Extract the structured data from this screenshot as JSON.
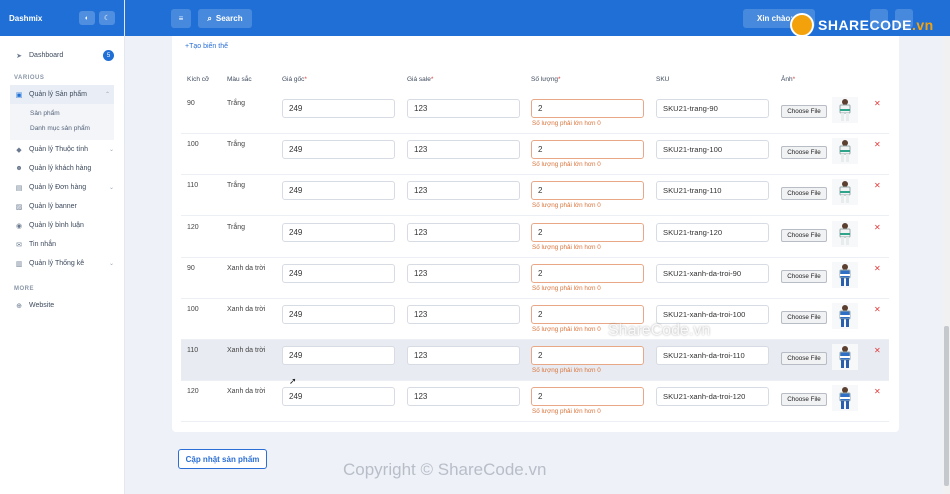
{
  "brand": {
    "name": "Dashmix",
    "theme_icon": "toggle-icon",
    "moon_icon": "moon-icon"
  },
  "topbar": {
    "search_label": "Search",
    "user_label": "Xin chào: H",
    "logo_text": "SHARECODE",
    "logo_tld": ".vn"
  },
  "sidebar": {
    "dashboard": {
      "label": "Dashboard",
      "badge": "5"
    },
    "section_various": "VARIOUS",
    "products": {
      "label": "Quản lý Sản phẩm",
      "sub": [
        "Sản phẩm",
        "Danh mục sản phẩm"
      ]
    },
    "items": [
      {
        "label": "Quản lý Thuộc tính",
        "icon": "tag-icon",
        "chev": true
      },
      {
        "label": "Quản lý khách hàng",
        "icon": "users-icon",
        "chev": false
      },
      {
        "label": "Quản lý Đơn hàng",
        "icon": "cart-icon",
        "chev": true
      },
      {
        "label": "Quản lý banner",
        "icon": "image-icon",
        "chev": false
      },
      {
        "label": "Quản lý bình luận",
        "icon": "comment-icon",
        "chev": false
      },
      {
        "label": "Tin nhắn",
        "icon": "mail-icon",
        "chev": false
      },
      {
        "label": "Quản lý Thống kê",
        "icon": "chart-icon",
        "chev": true
      }
    ],
    "section_more": "MORE",
    "website": "Website"
  },
  "form": {
    "add_variant": "+Tạo biến thể",
    "headers": {
      "size": "Kích cỡ",
      "color": "Màu sắc",
      "price": "Giá gốc",
      "sale": "Giá sale",
      "qty": "Số lượng",
      "sku": "SKU",
      "image": "Ảnh"
    },
    "required_mark": "*",
    "file_button": "Choose File",
    "error_msg": "Số lượng phải lớn hơn 0",
    "rows": [
      {
        "size": "90",
        "color": "Trắng",
        "price": "249",
        "sale": "123",
        "qty": "2",
        "sku": "SKU21-trang-90"
      },
      {
        "size": "100",
        "color": "Trắng",
        "price": "249",
        "sale": "123",
        "qty": "2",
        "sku": "SKU21-trang-100"
      },
      {
        "size": "110",
        "color": "Trắng",
        "price": "249",
        "sale": "123",
        "qty": "2",
        "sku": "SKU21-trang-110"
      },
      {
        "size": "120",
        "color": "Trắng",
        "price": "249",
        "sale": "123",
        "qty": "2",
        "sku": "SKU21-trang-120"
      },
      {
        "size": "90",
        "color": "Xanh da trời",
        "price": "249",
        "sale": "123",
        "qty": "2",
        "sku": "SKU21-xanh-da-troi-90"
      },
      {
        "size": "100",
        "color": "Xanh da trời",
        "price": "249",
        "sale": "123",
        "qty": "2",
        "sku": "SKU21-xanh-da-troi-100"
      },
      {
        "size": "110",
        "color": "Xanh da trời",
        "price": "249",
        "sale": "123",
        "qty": "2",
        "sku": "SKU21-xanh-da-troi-110"
      },
      {
        "size": "120",
        "color": "Xanh da trời",
        "price": "249",
        "sale": "123",
        "qty": "2",
        "sku": "SKU21-xanh-da-troi-120"
      }
    ],
    "update_button": "Cập nhật sản phẩm"
  },
  "watermarks": {
    "center": "ShareCode.vn",
    "bottom": "Copyright © ShareCode.vn"
  },
  "colors": {
    "primary": "#1f6fd6",
    "error": "#d9743c",
    "danger": "#e23b3b",
    "accent": "#f4a20c"
  }
}
